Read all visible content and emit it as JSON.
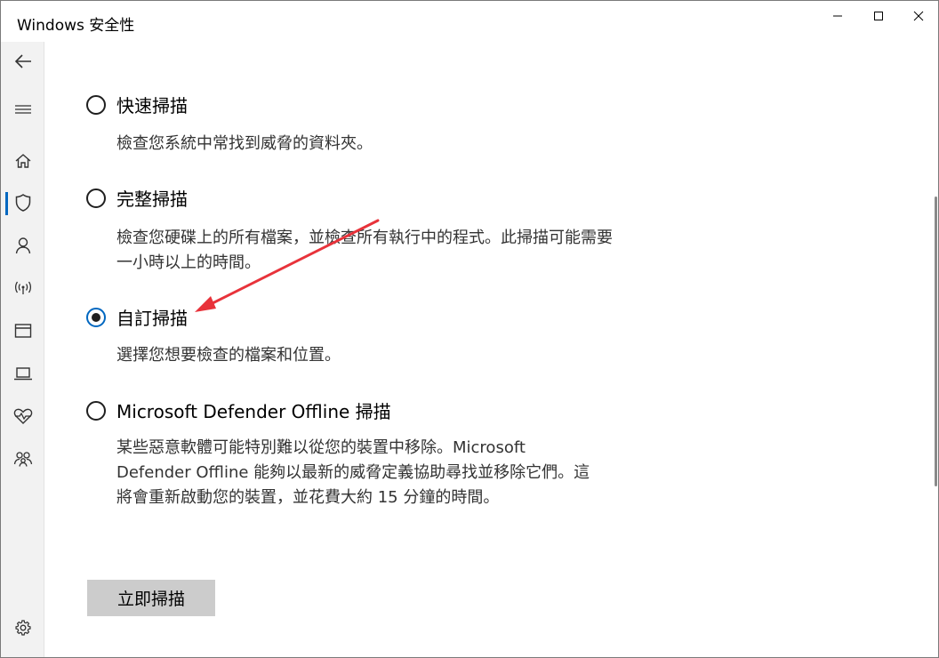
{
  "window": {
    "title": "Windows 安全性"
  },
  "sidebar": {
    "items": [
      {
        "name": "back",
        "icon": "back-arrow-icon"
      },
      {
        "name": "menu",
        "icon": "hamburger-menu-icon"
      },
      {
        "name": "home",
        "icon": "home-icon"
      },
      {
        "name": "virus-threat-protection",
        "icon": "shield-icon",
        "active": true
      },
      {
        "name": "account-protection",
        "icon": "person-icon"
      },
      {
        "name": "firewall-network",
        "icon": "wifi-antenna-icon"
      },
      {
        "name": "app-browser-control",
        "icon": "browser-window-icon"
      },
      {
        "name": "device-security",
        "icon": "laptop-icon"
      },
      {
        "name": "device-performance-health",
        "icon": "heart-pulse-icon"
      },
      {
        "name": "family-options",
        "icon": "family-icon"
      },
      {
        "name": "settings",
        "icon": "gear-icon"
      }
    ]
  },
  "scan_options": [
    {
      "label": "快速掃描",
      "description": "檢查您系統中常找到威脅的資料夾。",
      "selected": false
    },
    {
      "label": "完整掃描",
      "description": "檢查您硬碟上的所有檔案，並檢查所有執行中的程式。此掃描可能需要一小時以上的時間。",
      "selected": false
    },
    {
      "label": "自訂掃描",
      "description": "選擇您想要檢查的檔案和位置。",
      "selected": true
    },
    {
      "label": "Microsoft Defender Offline 掃描",
      "description": "某些惡意軟體可能特別難以從您的裝置中移除。Microsoft Defender Offline 能夠以最新的威脅定義協助尋找並移除它們。這將會重新啟動您的裝置，並花費大約 15 分鐘的時間。",
      "selected": false
    }
  ],
  "actions": {
    "scan_now_label": "立即掃描"
  },
  "colors": {
    "accent": "#0067c0",
    "annotation_arrow": "#e8323a"
  }
}
